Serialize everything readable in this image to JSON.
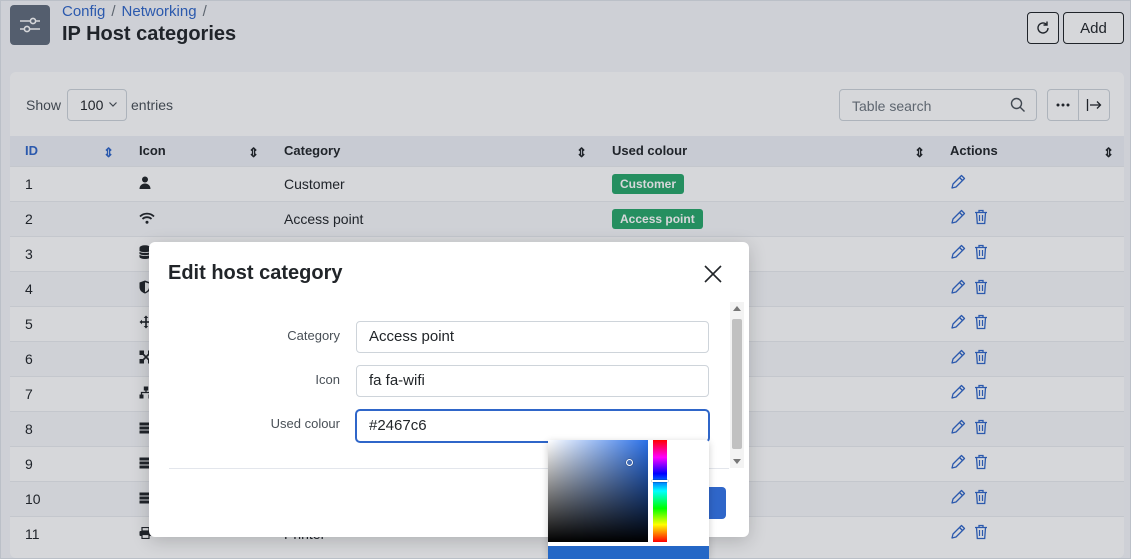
{
  "breadcrumb": {
    "items": [
      "Config",
      "Networking"
    ]
  },
  "page": {
    "title": "IP Host categories"
  },
  "header": {
    "add_label": "Add"
  },
  "toolbar": {
    "show_label": "Show",
    "entries_value": "100",
    "entries_label": "entries",
    "search_placeholder": "Table search"
  },
  "table": {
    "columns": [
      "ID",
      "Icon",
      "Category",
      "Used colour",
      "Actions"
    ],
    "rows": [
      {
        "id": "1",
        "icon": "user-icon",
        "category": "Customer",
        "colour_label": "Customer",
        "deletable": false
      },
      {
        "id": "2",
        "icon": "wifi-icon",
        "category": "Access point",
        "colour_label": "Access point",
        "deletable": true
      },
      {
        "id": "3",
        "icon": "database-icon",
        "category": "",
        "colour_label": "",
        "deletable": true
      },
      {
        "id": "4",
        "icon": "shield-icon",
        "category": "",
        "colour_label": "",
        "deletable": true
      },
      {
        "id": "5",
        "icon": "arrows-icon",
        "category": "",
        "colour_label": "",
        "deletable": true
      },
      {
        "id": "6",
        "icon": "network-icon",
        "category": "",
        "colour_label": "",
        "deletable": true
      },
      {
        "id": "7",
        "icon": "sitemap-icon",
        "category": "",
        "colour_label": "",
        "deletable": true
      },
      {
        "id": "8",
        "icon": "server-icon",
        "category": "",
        "colour_label": "",
        "deletable": true
      },
      {
        "id": "9",
        "icon": "server-icon",
        "category": "",
        "colour_label": "",
        "deletable": true
      },
      {
        "id": "10",
        "icon": "server-icon",
        "category": "",
        "colour_label": "",
        "deletable": true
      },
      {
        "id": "11",
        "icon": "printer-icon",
        "category": "Printer",
        "colour_label": "",
        "deletable": true
      }
    ]
  },
  "modal": {
    "title": "Edit host category",
    "fields": {
      "category": {
        "label": "Category",
        "value": "Access point"
      },
      "icon": {
        "label": "Icon",
        "value": "fa fa-wifi"
      },
      "colour": {
        "label": "Used colour",
        "value": "#2467c6"
      }
    }
  },
  "colors": {
    "accent": "#2f66c9",
    "badge_green": "#28a86b",
    "picked": "#2467c6"
  }
}
